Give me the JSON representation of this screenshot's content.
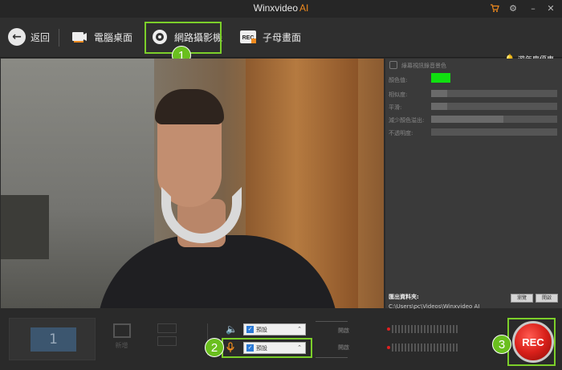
{
  "app": {
    "title": "Winxvideo",
    "title_suffix": "AI"
  },
  "window_controls": {
    "cart": "cart-icon",
    "settings": "gear-icon",
    "minimize": "–",
    "close": "✕"
  },
  "toolbar": {
    "back_label": "返回",
    "tabs": [
      {
        "label": "電腦桌面",
        "icon": "monitor-camera-icon"
      },
      {
        "label": "網路攝影機",
        "icon": "webcam-icon"
      },
      {
        "label": "子母畫面",
        "icon": "rec-icon"
      }
    ],
    "promo_label": "遊年慶優惠"
  },
  "callouts": [
    "1",
    "2",
    "3"
  ],
  "right_panel": {
    "chroma_label": "綠幕視訊錄音景色",
    "color_label": "顏色值:",
    "similarity_label": "相似度:",
    "smooth_label": "平滑:",
    "spill_label": "減少顏色溢出:",
    "opacity_label": "不透明度:",
    "key_color": "#10e010",
    "save_folder_label": "匯出資料夾:",
    "save_folder_path": "C:\\Users\\pc\\Videos\\Winxvideo AI",
    "browse_label": "瀏覽",
    "open_label": "開啟"
  },
  "bottom": {
    "scene_number": "1",
    "add_label": "新增",
    "speaker_device": "預設",
    "mic_device": "預設",
    "speaker_state": "開啟",
    "mic_state": "開啟",
    "rec_label": "REC"
  }
}
